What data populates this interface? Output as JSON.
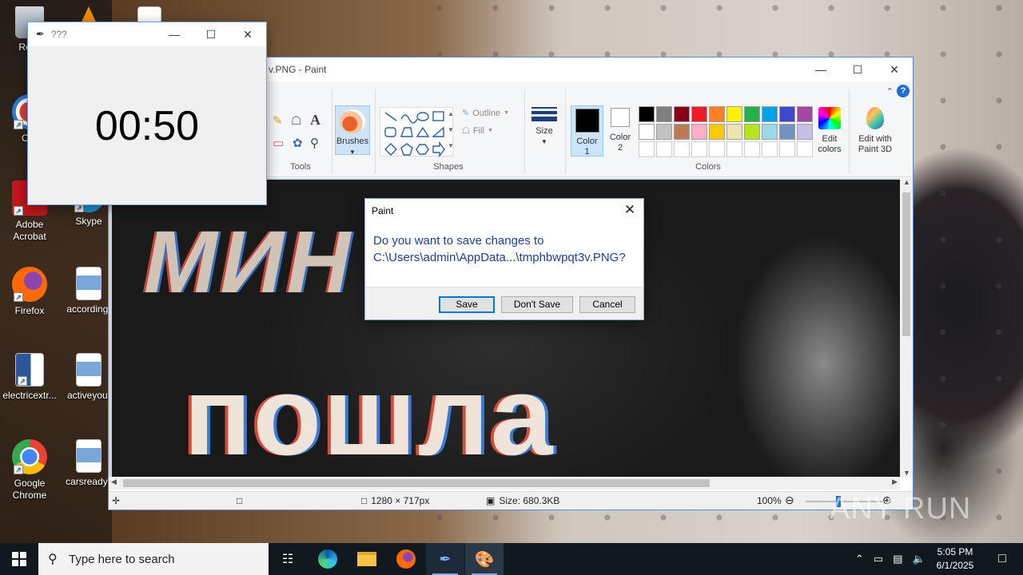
{
  "desktop": {
    "icons": [
      {
        "label": "Recy"
      },
      {
        "label": "CCl"
      },
      {
        "label": "Adobe Acrobat"
      },
      {
        "label": "Skype"
      },
      {
        "label": "Firefox"
      },
      {
        "label": "according."
      },
      {
        "label": "electricextr..."
      },
      {
        "label": "activeyout"
      },
      {
        "label": "Google Chrome"
      },
      {
        "label": "carsready.j"
      }
    ]
  },
  "timer_window": {
    "title": "???",
    "value": "00:50"
  },
  "paint": {
    "title": "v.PNG - Paint",
    "groups": {
      "tools": "Tools",
      "shapes": "Shapes",
      "colors": "Colors"
    },
    "buttons": {
      "brushes": "Brushes",
      "outline": "Outline",
      "fill": "Fill",
      "size": "Size",
      "color1": "Color 1",
      "color2": "Color 2",
      "edit_colors": "Edit colors",
      "edit_3d": "Edit with Paint 3D"
    },
    "palette_row1": [
      "#000000",
      "#7f7f7f",
      "#880015",
      "#ed1c24",
      "#ff7f27",
      "#fff200",
      "#22b14c",
      "#00a2e8",
      "#3f48cc",
      "#a349a4"
    ],
    "palette_row2": [
      "#ffffff",
      "#c3c3c3",
      "#b97a57",
      "#ffaec9",
      "#ffc90e",
      "#efe4b0",
      "#b5e61d",
      "#99d9ea",
      "#7092be",
      "#c8bfe7"
    ],
    "canvas_text": {
      "line1": "МИН",
      "line2": "пошла"
    },
    "status": {
      "dimensions": "1280 × 717px",
      "size": "Size: 680.3KB",
      "zoom": "100%"
    }
  },
  "dialog": {
    "title": "Paint",
    "message_line1": "Do you want to save changes to",
    "message_line2": "C:\\Users\\admin\\AppData...\\tmphbwpqt3v.PNG?",
    "save": "Save",
    "dont_save": "Don't Save",
    "cancel": "Cancel"
  },
  "taskbar": {
    "search_placeholder": "Type here to search",
    "time": "5:05 PM",
    "date": "6/1/2025"
  },
  "watermark": "ANY RUN"
}
